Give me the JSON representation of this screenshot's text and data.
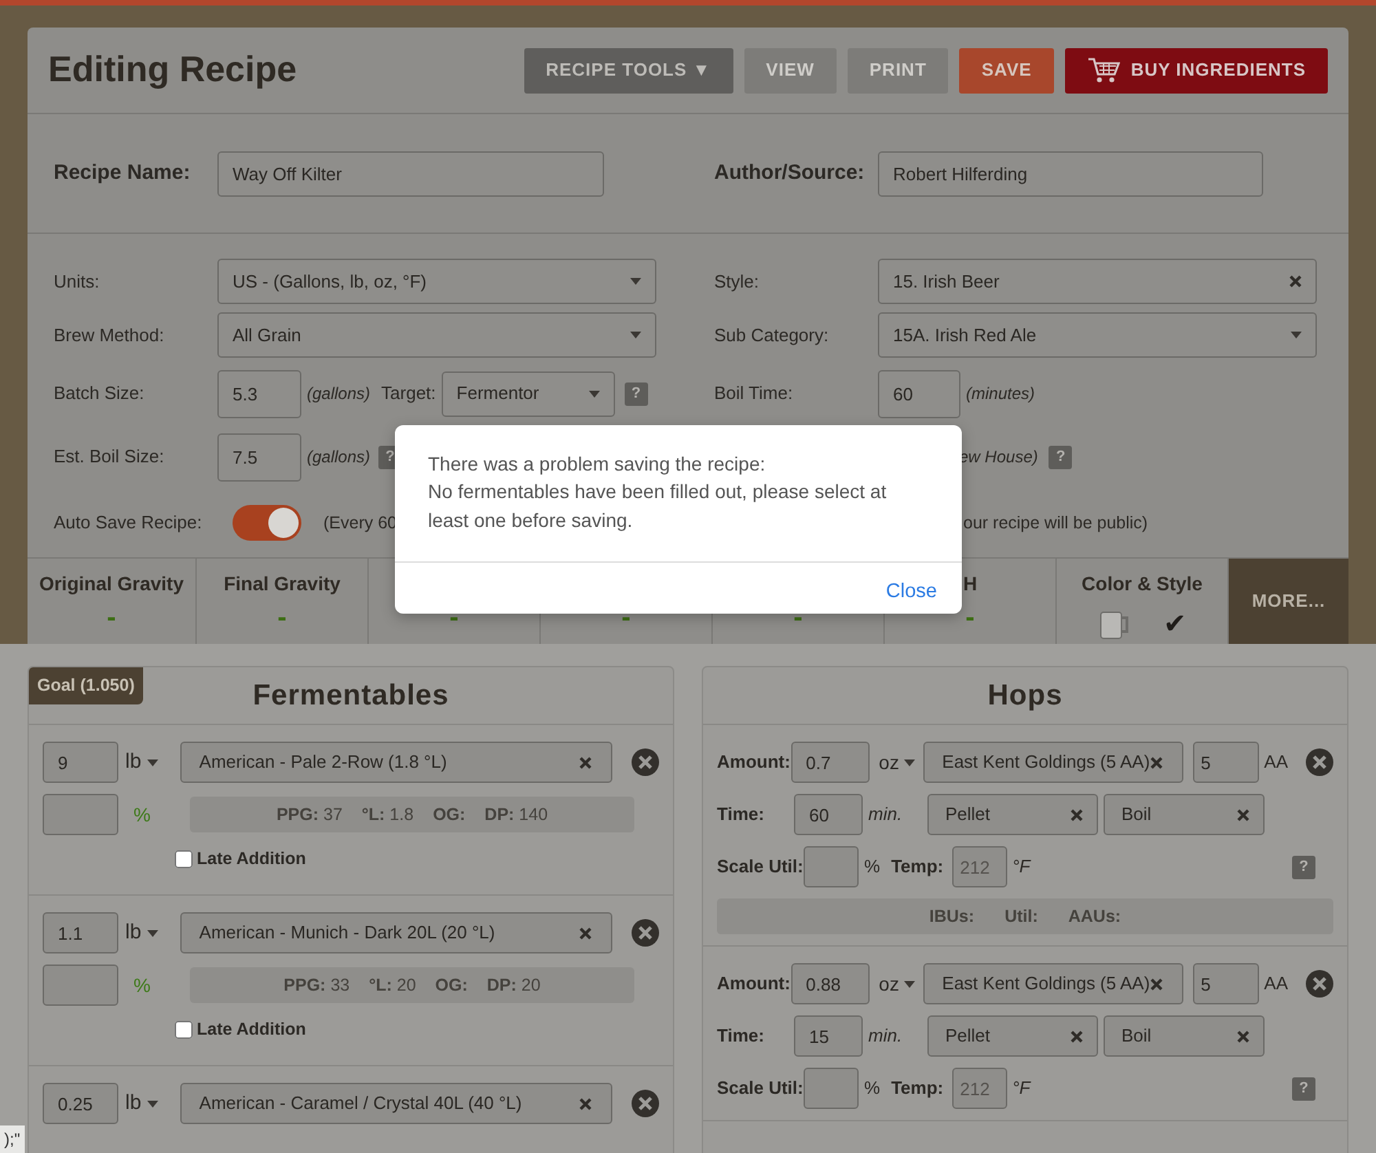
{
  "header": {
    "title": "Editing Recipe",
    "buttons": [
      {
        "label": "RECIPE TOOLS ▼",
        "kind": "tools"
      },
      {
        "label": "VIEW",
        "kind": "disabled"
      },
      {
        "label": "PRINT",
        "kind": "disabled"
      },
      {
        "label": "SAVE",
        "kind": "save"
      },
      {
        "label": "BUY INGREDIENTS",
        "kind": "buy"
      }
    ]
  },
  "recipe": {
    "name_label": "Recipe Name:",
    "name": "Way Off Kilter",
    "author_label": "Author/Source:",
    "author": "Robert Hilferding"
  },
  "units": {
    "label": "Units:",
    "value": "US - (Gallons, lb, oz, °F)"
  },
  "brew_method": {
    "label": "Brew Method:",
    "value": "All Grain"
  },
  "batch_size": {
    "label": "Batch Size:",
    "value": "5.3",
    "unit": "(gallons)",
    "target_label": "Target:",
    "target": "Fermentor",
    "help": "?"
  },
  "est_boil_size": {
    "label": "Est. Boil Size:",
    "value": "7.5",
    "unit": "(gallons)",
    "help": "?"
  },
  "auto_save": {
    "label": "Auto Save Recipe:",
    "on": true,
    "note": "(Every 60"
  },
  "style": {
    "label": "Style:",
    "value": "15. Irish Beer"
  },
  "sub_category": {
    "label": "Sub Category:",
    "value": "15A. Irish Red Ale"
  },
  "boil_time": {
    "label": "Boil Time:",
    "value": "60",
    "unit": "(minutes)"
  },
  "partial_row": {
    "note": "ew House)",
    "help": "?"
  },
  "public_note": "our recipe will be public)",
  "stats": [
    {
      "label": "Original Gravity",
      "value": "-"
    },
    {
      "label": "Final Gravity",
      "value": "-"
    },
    {
      "value": "-"
    },
    {
      "value": "-"
    },
    {
      "value": "-"
    },
    {
      "label": "H",
      "value": "-"
    }
  ],
  "color_style": {
    "label": "Color & Style",
    "check": "✔"
  },
  "more": "MORE...",
  "modal": {
    "lines": [
      "There was a problem saving the recipe:",
      "No fermentables have been filled out, please select at least one before saving."
    ],
    "close": "Close"
  },
  "fermentables": {
    "goal": "Goal (1.050)",
    "title": "Fermentables",
    "items": [
      {
        "amount": "9",
        "unit": "lb",
        "name": "American - Pale 2-Row (1.8 °L)",
        "percent_symbol": "%",
        "stats": [
          {
            "label": "PPG:",
            "value": "37"
          },
          {
            "label": "°L:",
            "value": "1.8"
          },
          {
            "label": "OG:"
          },
          {
            "label": "DP:",
            "value": "140"
          }
        ],
        "late_addition": {
          "label": "Late Addition",
          "checked": false
        }
      },
      {
        "amount": "1.1",
        "unit": "lb",
        "name": "American - Munich - Dark 20L (20 °L)",
        "percent_symbol": "%",
        "stats": [
          {
            "label": "PPG:",
            "value": "33"
          },
          {
            "label": "°L:",
            "value": "20"
          },
          {
            "label": "OG:"
          },
          {
            "label": "DP:",
            "value": "20"
          }
        ],
        "late_addition": {
          "label": "Late Addition",
          "checked": false
        }
      },
      {
        "amount": "0.25",
        "unit": "lb",
        "name": "American - Caramel / Crystal 40L (40 °L)"
      }
    ]
  },
  "hops": {
    "title": "Hops",
    "items": [
      {
        "amount_label": "Amount:",
        "amount": "0.7",
        "unit": "oz",
        "variety": "East Kent Goldings (5 AA)",
        "aa": "5",
        "aa_label": "AA",
        "time_label": "Time:",
        "time": "60",
        "time_unit": "min.",
        "form": "Pellet",
        "use": "Boil",
        "scale_label": "Scale Util:",
        "pct": "%",
        "temp_label": "Temp:",
        "temp_placeholder": "212",
        "temp_unit": "°F",
        "help": "?",
        "results": [
          "IBUs:",
          "Util:",
          "AAUs:"
        ]
      },
      {
        "amount_label": "Amount:",
        "amount": "0.88",
        "unit": "oz",
        "variety": "East Kent Goldings (5 AA)",
        "aa": "5",
        "aa_label": "AA",
        "time_label": "Time:",
        "time": "15",
        "time_unit": "min.",
        "form": "Pellet",
        "use": "Boil",
        "scale_label": "Scale Util:",
        "pct": "%",
        "temp_label": "Temp:",
        "temp_placeholder": "212",
        "temp_unit": "°F",
        "help": "?"
      }
    ]
  },
  "code_fragment": ");\""
}
